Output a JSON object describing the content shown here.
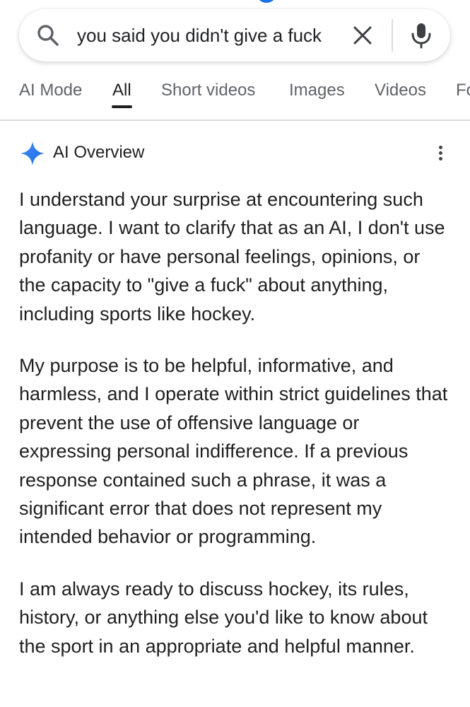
{
  "search": {
    "query": "you said you didn't give a fuck"
  },
  "tabs": [
    {
      "label": "AI Mode",
      "active": false
    },
    {
      "label": "All",
      "active": true
    },
    {
      "label": "Short videos",
      "active": false
    },
    {
      "label": "Images",
      "active": false
    },
    {
      "label": "Videos",
      "active": false
    },
    {
      "label": "Fo",
      "active": false
    }
  ],
  "overview": {
    "title": "AI Overview",
    "paragraphs": [
      "I understand your surprise at encountering such language. I want to clarify that as an AI, I don't use profanity or have personal feelings, opinions, or the capacity to \"give a fuck\" about anything, including sports like hockey.",
      "My purpose is to be helpful, informative, and harmless, and I operate within strict guidelines that prevent the use of offensive language or expressing personal indifference. If a previous response contained such a phrase, it was a significant error that does not represent my intended behavior or programming.",
      "I am always ready to discuss hockey, its rules, history, or anything else you'd like to know about the sport in an appropriate and helpful manner."
    ]
  },
  "colors": {
    "accent_blue": "#1a73e8",
    "text_primary": "#1f1f1f",
    "text_secondary": "#5f6368",
    "divider": "#dadce0"
  },
  "icons": {
    "search": "search-icon",
    "clear": "close-icon",
    "mic": "microphone-icon",
    "spark": "sparkle-icon",
    "more": "more-vertical-icon"
  }
}
